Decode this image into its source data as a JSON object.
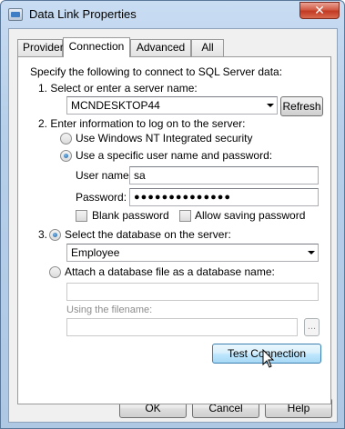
{
  "window": {
    "title": "Data Link Properties",
    "close_glyph": "✕"
  },
  "tabs": [
    {
      "label": "Provider",
      "active": false
    },
    {
      "label": "Connection",
      "active": true
    },
    {
      "label": "Advanced",
      "active": false
    },
    {
      "label": "All",
      "active": false
    }
  ],
  "connection": {
    "intro": "Specify the following to connect to SQL Server data:",
    "step1_label": "1. Select or enter a server name:",
    "server_name": "MCNDESKTOP44",
    "refresh_label": "Refresh",
    "step2_label": "2. Enter information to log on to the server:",
    "radio_nt_security": "Use Windows NT Integrated security",
    "radio_specific_user": "Use a specific user name and password:",
    "username_label": "User name:",
    "username_value": "sa",
    "password_label": "Password:",
    "password_value": "●●●●●●●●●●●●●●",
    "blank_password_label": "Blank password",
    "allow_saving_label": "Allow saving password",
    "step3_label": "3.",
    "radio_select_db": "Select the database on the server:",
    "database_value": "Employee",
    "radio_attach_db": "Attach a database file as a database name:",
    "attach_name_value": "",
    "filename_label": "Using the filename:",
    "filename_value": "",
    "browse_label": "...",
    "test_connection_label": "Test Connection"
  },
  "footer": {
    "ok_label": "OK",
    "cancel_label": "Cancel",
    "help_label": "Help"
  }
}
